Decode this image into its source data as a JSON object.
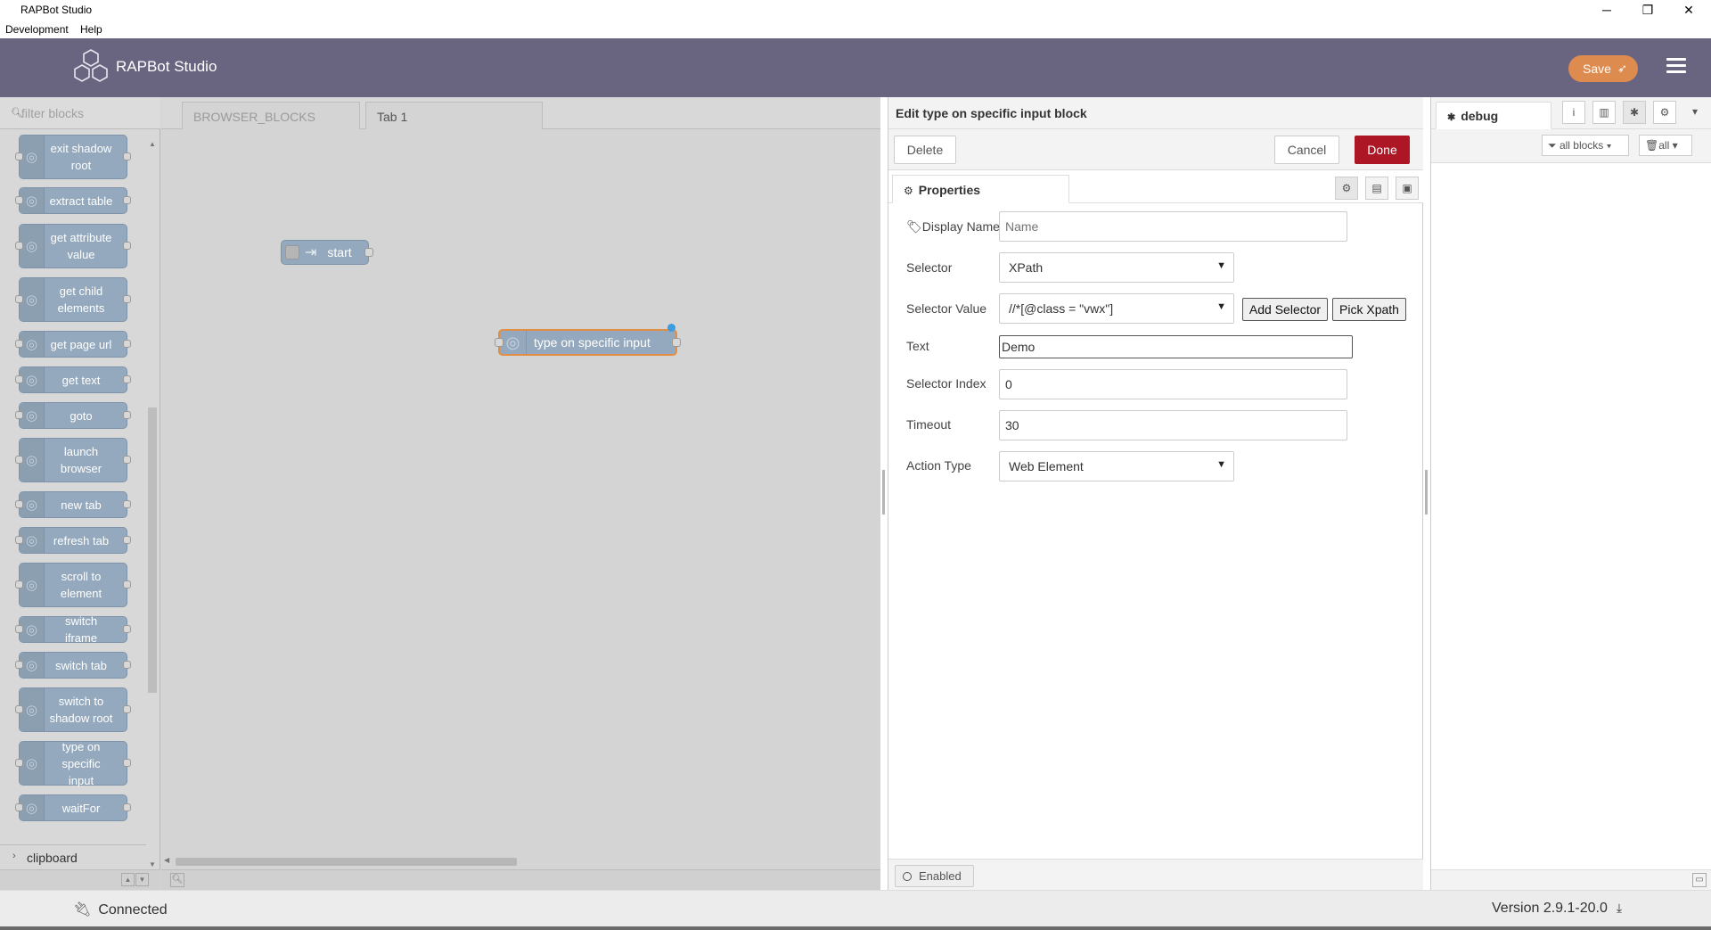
{
  "window": {
    "title": "RAPBot Studio",
    "controls": {
      "minimize": "─",
      "restore": "❐",
      "close": "✕"
    }
  },
  "menubar": [
    "Development",
    "Help"
  ],
  "header": {
    "brand": "RAPBot Studio",
    "save_label": "Save",
    "colors": {
      "header_bg": "#696580",
      "save_bg": "#de8b4f"
    }
  },
  "palette": {
    "filter_placeholder": "filter blocks",
    "items": [
      "exit shadow root",
      "extract table",
      "get attribute value",
      "get child elements",
      "get page url",
      "get text",
      "goto",
      "launch browser",
      "new tab",
      "refresh tab",
      "scroll to element",
      "switch iframe",
      "switch tab",
      "switch to shadow root",
      "type on specific input",
      "waitFor"
    ],
    "category": "clipboard"
  },
  "workspace": {
    "tabs": [
      "BROWSER_BLOCKS",
      "Tab 1"
    ],
    "active_tab": "Tab 1",
    "nodes": [
      {
        "label": "start",
        "icon": "arrow-icon"
      },
      {
        "label": "type on specific input",
        "icon": "globe-icon"
      }
    ]
  },
  "editor": {
    "title": "Edit type on specific input block",
    "delete_label": "Delete",
    "cancel_label": "Cancel",
    "done_label": "Done",
    "properties_tab": "Properties",
    "fields": {
      "display_name": {
        "label": "Display Name",
        "value": "",
        "placeholder": "Name"
      },
      "selector": {
        "label": "Selector",
        "value": "XPath"
      },
      "selector_value": {
        "label": "Selector Value",
        "value": "//*[@class = \"vwx\"]"
      },
      "add_selector_label": "Add Selector",
      "pick_xpath_label": "Pick Xpath",
      "text": {
        "label": "Text",
        "value": "Demo"
      },
      "selector_index": {
        "label": "Selector Index",
        "value": "0"
      },
      "timeout": {
        "label": "Timeout",
        "value": "30"
      },
      "action_type": {
        "label": "Action Type",
        "value": "Web Element"
      }
    },
    "enabled_label": "Enabled",
    "colors": {
      "done_bg": "#ad1625"
    }
  },
  "sidebar": {
    "tab_label": "debug",
    "filter_blocks": "all blocks",
    "clear_all": "all"
  },
  "status": {
    "connection": "Connected",
    "version": "Version 2.9.1-20.0"
  }
}
